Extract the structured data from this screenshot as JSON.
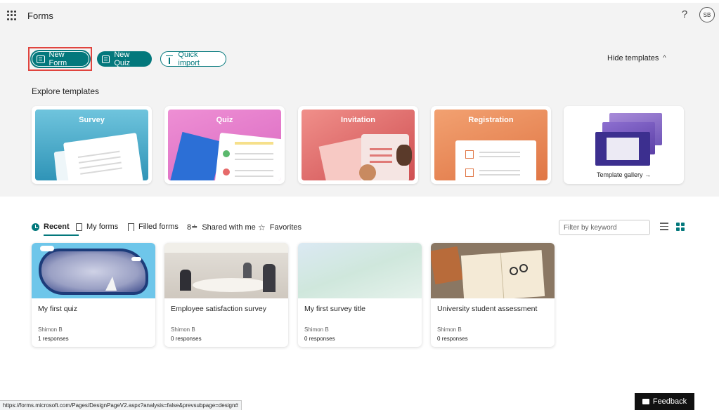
{
  "header": {
    "app_title": "Forms",
    "help_glyph": "?",
    "avatar_initials": "SB"
  },
  "actions": {
    "new_form": "New Form",
    "new_quiz": "New Quiz",
    "quick_import": "Quick import",
    "hide_templates": "Hide templates",
    "hide_templates_glyph": "^"
  },
  "templates": {
    "title": "Explore templates",
    "items": [
      {
        "label": "Survey"
      },
      {
        "label": "Quiz"
      },
      {
        "label": "Invitation"
      },
      {
        "label": "Registration"
      }
    ],
    "gallery_label": "Template gallery →"
  },
  "tabs": [
    {
      "label": "Recent",
      "active": true
    },
    {
      "label": "My forms"
    },
    {
      "label": "Filled forms"
    },
    {
      "label": "Shared with me",
      "glyph": "8≐"
    },
    {
      "label": "Favorites",
      "glyph": "☆"
    }
  ],
  "filter": {
    "placeholder": "Filter by keyword"
  },
  "forms": [
    {
      "title": "My first quiz",
      "owner": "Shimon B",
      "responses": "1 responses"
    },
    {
      "title": "Employee satisfaction survey",
      "owner": "Shimon B",
      "responses": "0 responses"
    },
    {
      "title": "My first survey title",
      "owner": "Shimon B",
      "responses": "0 responses"
    },
    {
      "title": "University student assessment",
      "owner": "Shimon B",
      "responses": "0 responses"
    }
  ],
  "status_bar": {
    "url": "https://forms.microsoft.com/Pages/DesignPageV2.aspx?analysis=false&prevsubpage=design#"
  },
  "feedback": {
    "label": "Feedback"
  },
  "colors": {
    "accent": "#03787c",
    "highlight": "#e0443e"
  }
}
